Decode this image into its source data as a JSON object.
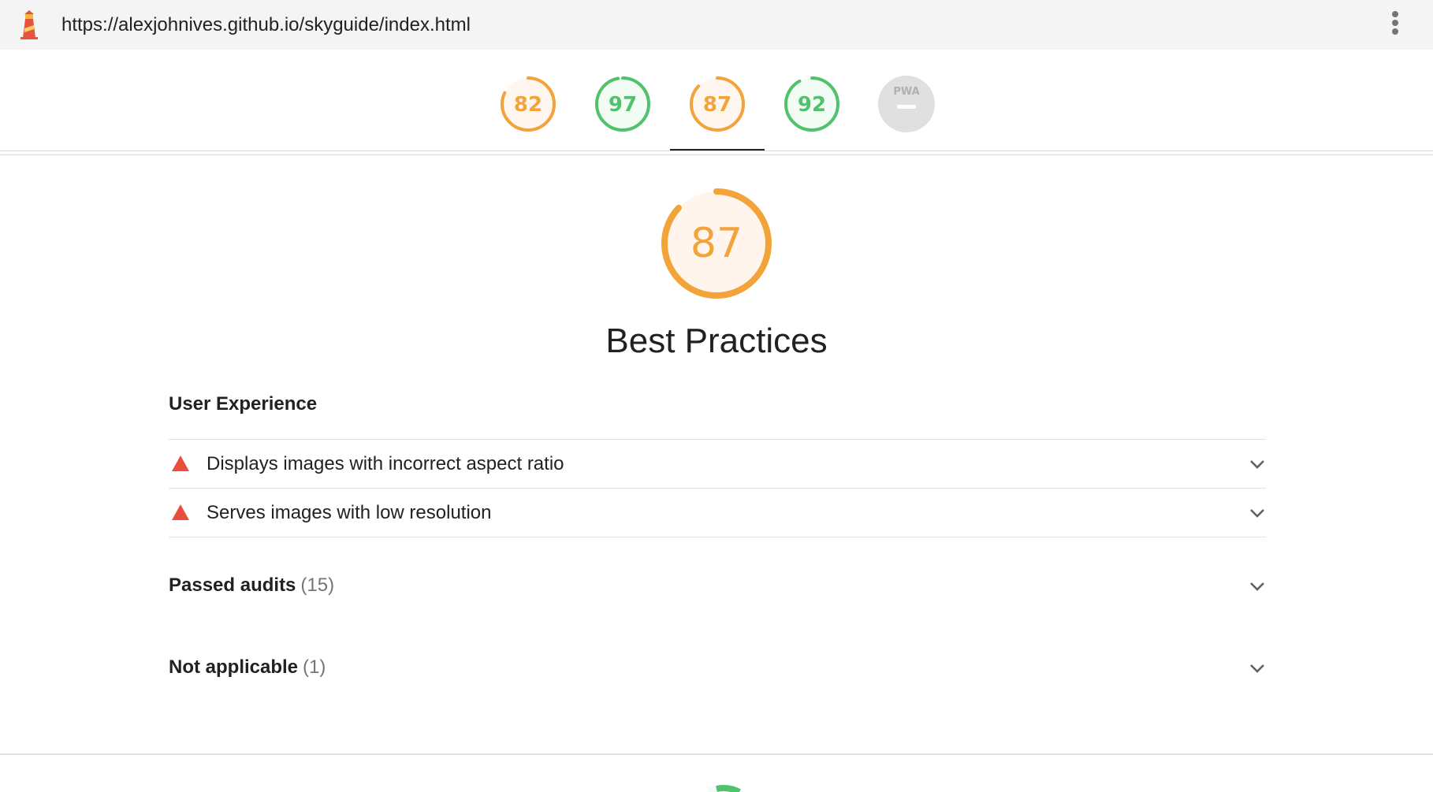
{
  "topbar": {
    "url": "https://alexjohnives.github.io/skyguide/index.html",
    "logo_icon": "lighthouse-icon",
    "menu_icon": "kebab-menu-icon"
  },
  "score_tabs": [
    {
      "score": "82",
      "score_value": 82,
      "category": "performance",
      "color": "#f2a33a",
      "fill": "#fff7ef",
      "active": false
    },
    {
      "score": "97",
      "score_value": 97,
      "category": "accessibility",
      "color": "#4fc26b",
      "fill": "#f2fbf4",
      "active": false
    },
    {
      "score": "87",
      "score_value": 87,
      "category": "best-practices",
      "color": "#f2a33a",
      "fill": "#fff7ef",
      "active": true
    },
    {
      "score": "92",
      "score_value": 92,
      "category": "seo",
      "color": "#4fc26b",
      "fill": "#f2fbf4",
      "active": false
    },
    {
      "score": "PWA",
      "category": "pwa",
      "color": "#b0b0b0",
      "fill": "#e0e0e0",
      "active": false
    }
  ],
  "main": {
    "score": "87",
    "score_value": 87,
    "title": "Best Practices",
    "color": "#f2a33a",
    "fill": "#fff5ec",
    "group_title": "User Experience",
    "audits": [
      {
        "title": "Displays images with incorrect aspect ratio",
        "status": "fail",
        "icon": "warning-triangle-icon",
        "color": "#eb4d3d"
      },
      {
        "title": "Serves images with low resolution",
        "status": "fail",
        "icon": "warning-triangle-icon",
        "color": "#eb4d3d"
      }
    ],
    "passed": {
      "label": "Passed audits",
      "count": "(15)"
    },
    "not_applicable": {
      "label": "Not applicable",
      "count": "(1)"
    }
  }
}
